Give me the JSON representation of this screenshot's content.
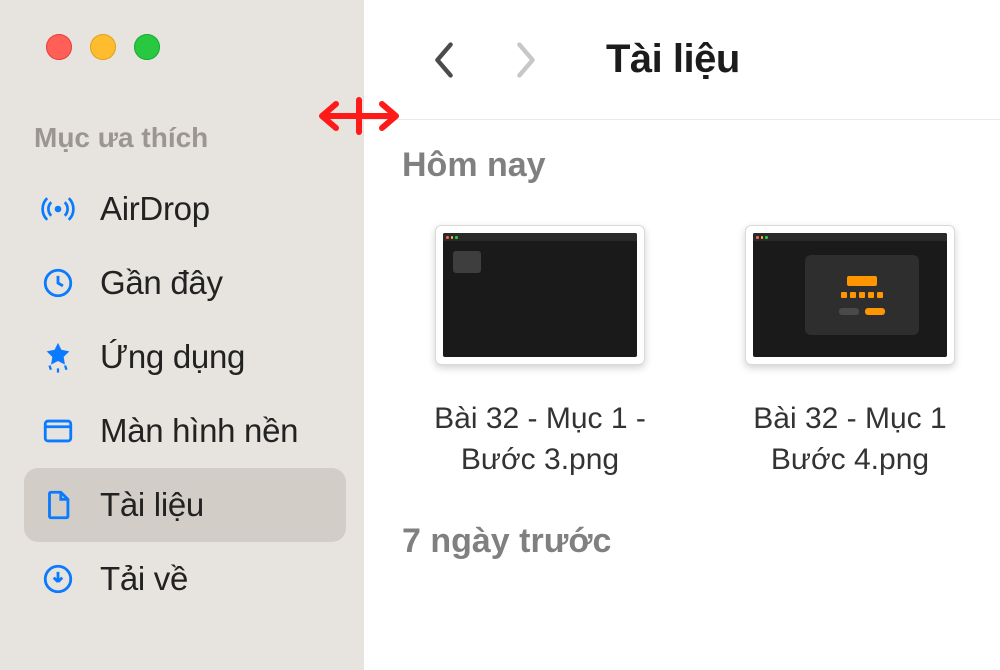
{
  "sidebar": {
    "section": "Mục ưa thích",
    "items": [
      {
        "icon": "airdrop",
        "label": "AirDrop",
        "selected": false
      },
      {
        "icon": "clock",
        "label": "Gần đây",
        "selected": false
      },
      {
        "icon": "apps",
        "label": "Ứng dụng",
        "selected": false
      },
      {
        "icon": "desktop",
        "label": "Màn hình nền",
        "selected": false
      },
      {
        "icon": "doc",
        "label": "Tài liệu",
        "selected": true
      },
      {
        "icon": "download",
        "label": "Tải về",
        "selected": false
      }
    ]
  },
  "toolbar": {
    "title": "Tài liệu"
  },
  "groups": {
    "today": "Hôm nay",
    "seven": "7 ngày trước"
  },
  "files": [
    {
      "name": "Bài 32 - Mục 1 -\nBước 3.png",
      "variant": "v1"
    },
    {
      "name": "Bài 32 - Mục 1\nBước 4.png",
      "variant": "v2"
    }
  ]
}
